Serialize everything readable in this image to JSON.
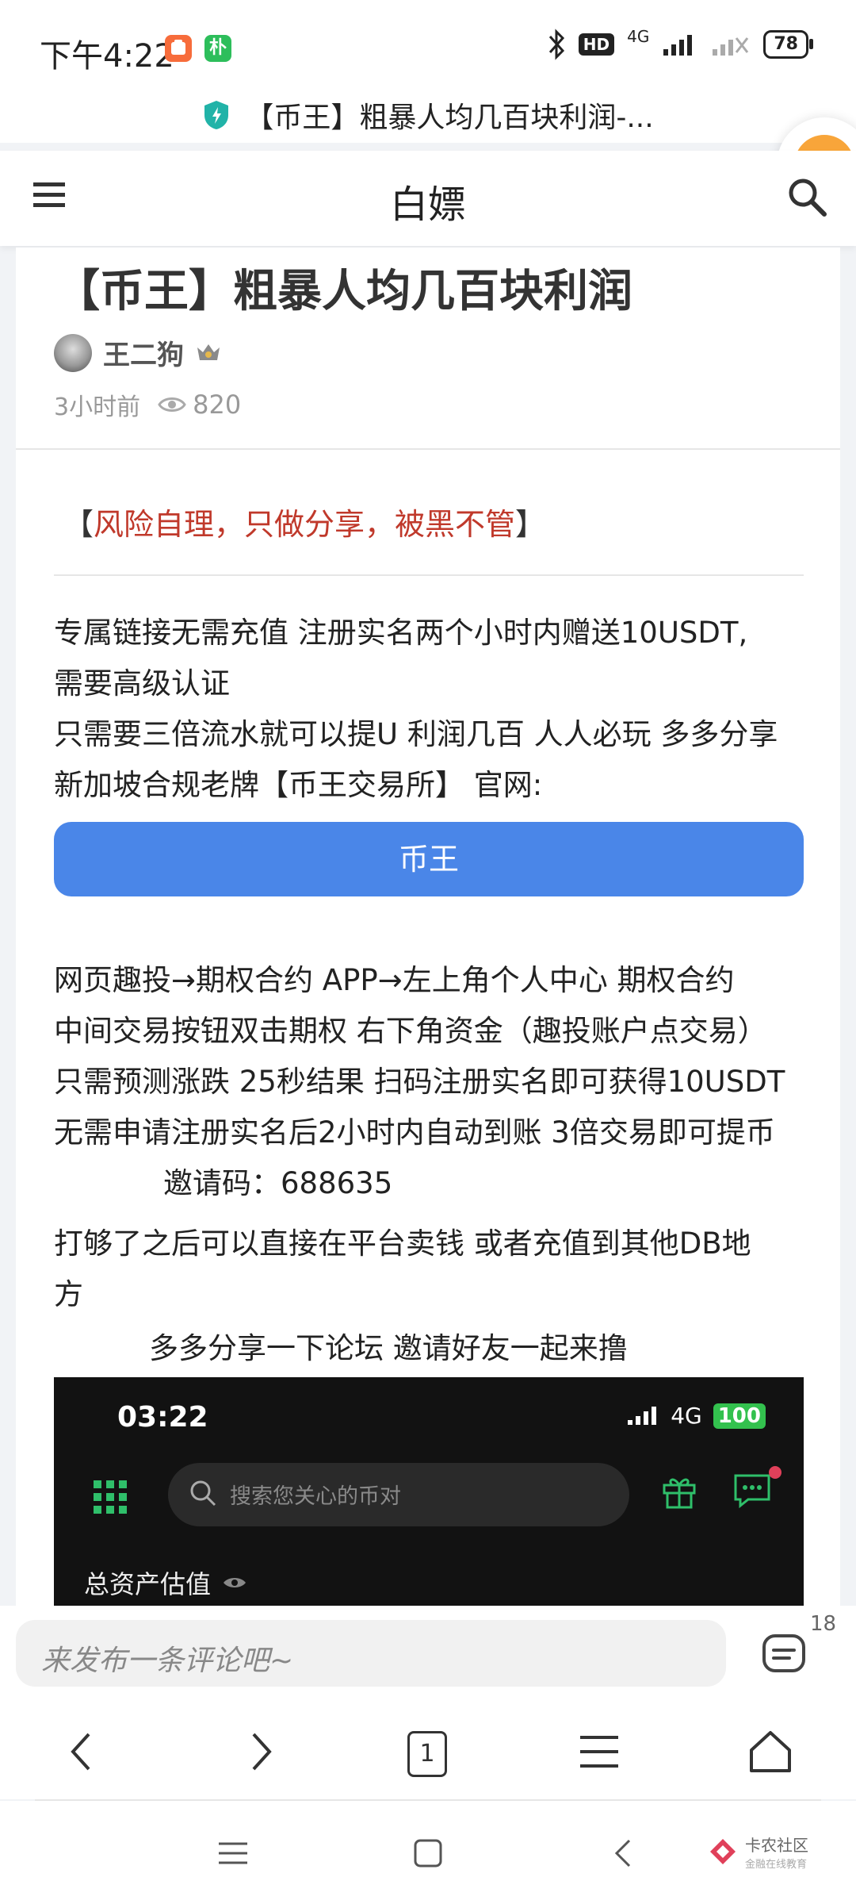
{
  "status_bar": {
    "time": "下午4:22",
    "app_icon_1_color": "#f76c3b",
    "app_icon_2_label": "朴",
    "app_icon_2_color": "#2dbe5b",
    "hd_label": "HD",
    "network_label": "4G",
    "battery": "78"
  },
  "url_bar": {
    "page_title": "【币王】粗暴人均几百块利润-..."
  },
  "header": {
    "title": "白嫖"
  },
  "article": {
    "title": "【币王】粗暴人均几百块利润",
    "author": "王二狗",
    "time_ago": "3小时前",
    "views": "820",
    "risk_open": "【",
    "risk_text": "风险自理，只做分享，被黑不管",
    "risk_close": "】",
    "p1_l1": "专属链接无需充值 注册实名两个小时内赠送10USDT,",
    "p1_l2": "需要高级认证",
    "p1_l3": "只需要三倍流水就可以提U 利润几百 人人必玩 多多分享",
    "p1_l4": "新加坡合规老牌【币王交易所】 官网:",
    "cta_label": "币王",
    "p2_l1": "网页趣投→期权合约 APP→左上角个人中心 期权合约",
    "p2_l2": " 中间交易按钮双击期权 右下角资金（趣投账户点交易）",
    "p2_l3": "只需预测涨跌 25秒结果 扫码注册实名即可获得10USDT",
    "p2_l4": "无需申请注册实名后2小时内自动到账 3倍交易即可提币",
    "invite_code": "邀请码：688635",
    "p3_l1": "打够了之后可以直接在平台卖钱 或者充值到其他DB地",
    "p3_l2": "方",
    "share_line": "多多分享一下论坛 邀请好友一起来撸"
  },
  "embedded_screenshot": {
    "time": "03:22",
    "network": "4G",
    "battery": "100",
    "search_placeholder": "搜索您关心的币对",
    "total_assets_label": "总资产估值"
  },
  "comment_bar": {
    "placeholder": "来发布一条评论吧~",
    "count": "18"
  },
  "browser_nav": {
    "tab_count": "1"
  },
  "watermark": {
    "name": "卡农社区",
    "sub": "金融在线教育"
  },
  "colors": {
    "accent_blue": "#4a86e8",
    "risk_red": "#c0392b",
    "embed_green": "#2fbf6a"
  }
}
